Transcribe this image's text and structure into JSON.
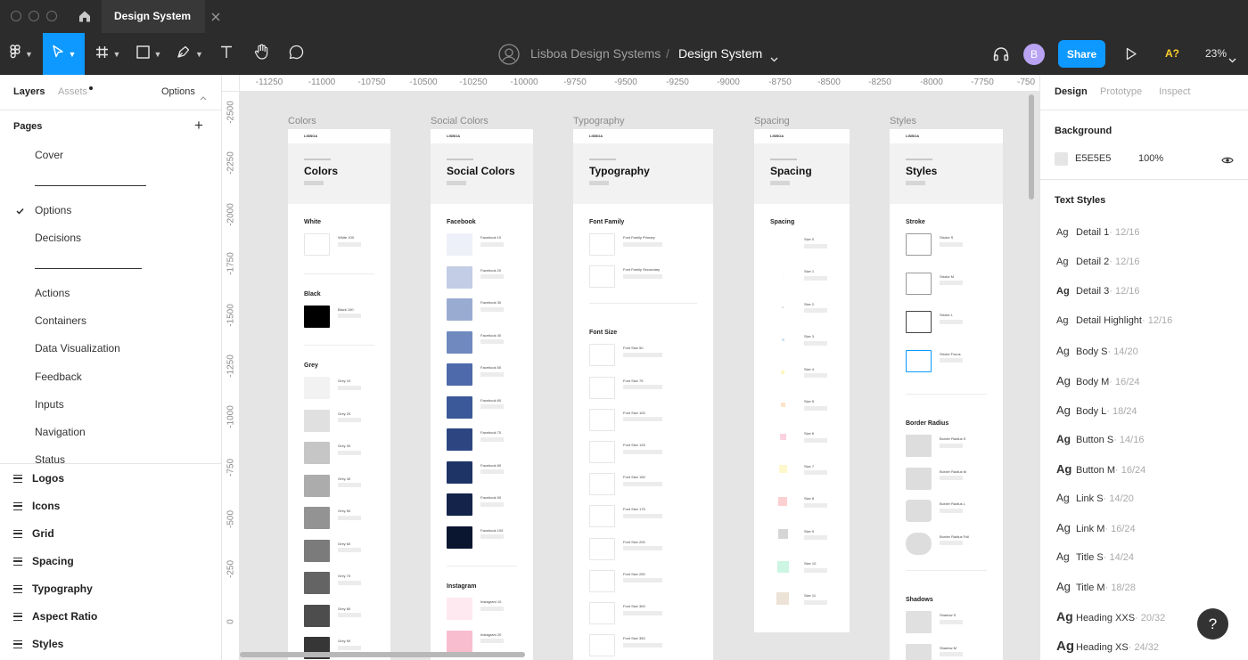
{
  "tabbar": {
    "file_tab": "Design System",
    "new_tab": "+"
  },
  "toolbar": {
    "team": "Lisboa Design Systems",
    "separator": "/",
    "file": "Design System",
    "avatar": "B",
    "share": "Share",
    "a11y": "A?",
    "zoom": "23%"
  },
  "left": {
    "tabs": {
      "layers": "Layers",
      "assets": "Assets",
      "options": "Options"
    },
    "pages_title": "Pages",
    "add": "+",
    "pages": [
      "Cover",
      "Options",
      "Decisions",
      "Actions",
      "Containers",
      "Data Visualization",
      "Feedback",
      "Inputs",
      "Navigation",
      "Status"
    ],
    "current_page": "Options",
    "layers": [
      "Logos",
      "Icons",
      "Grid",
      "Spacing",
      "Typography",
      "Aspect Ratio",
      "Styles"
    ]
  },
  "canvas": {
    "ruler_x": [
      "-11250",
      "-11000",
      "-10750",
      "-10500",
      "-10250",
      "-10000",
      "-9750",
      "-9500",
      "-9250",
      "-9000",
      "-8750",
      "-8500",
      "-8250",
      "-8000",
      "-7750",
      "-750"
    ],
    "ruler_y": [
      "-2500",
      "-2250",
      "-2000",
      "-1750",
      "-1500",
      "-1250",
      "-1000",
      "-750",
      "-500",
      "-250",
      "0"
    ],
    "frames": [
      {
        "label": "Colors",
        "title": "Colors",
        "brand": "LISBOA",
        "sections": [
          {
            "name": "White",
            "swatches": [
              {
                "color": "#ffffff",
                "label": "White 100"
              }
            ]
          },
          {
            "name": "Black",
            "swatches": [
              {
                "color": "#000000",
                "label": "Black 100"
              }
            ]
          },
          {
            "name": "Grey",
            "swatches": [
              {
                "color": "#f2f2f2",
                "label": "Grey 10"
              },
              {
                "color": "#e0e0e0",
                "label": "Grey 20"
              },
              {
                "color": "#c6c6c6",
                "label": "Grey 30"
              },
              {
                "color": "#acacac",
                "label": "Grey 40"
              },
              {
                "color": "#939393",
                "label": "Grey 50"
              },
              {
                "color": "#7b7b7b",
                "label": "Grey 60"
              },
              {
                "color": "#646464",
                "label": "Grey 70"
              },
              {
                "color": "#4d4d4d",
                "label": "Grey 80"
              },
              {
                "color": "#363636",
                "label": "Grey 90"
              }
            ]
          }
        ]
      },
      {
        "label": "Social Colors",
        "title": "Social Colors",
        "brand": "LISBOA",
        "sections": [
          {
            "name": "Facebook",
            "swatches": [
              {
                "color": "#edf0f8",
                "label": "Facebook 10"
              },
              {
                "color": "#c3cde5",
                "label": "Facebook 20"
              },
              {
                "color": "#9aabd2",
                "label": "Facebook 30"
              },
              {
                "color": "#7089bf",
                "label": "Facebook 40"
              },
              {
                "color": "#4e6aaa",
                "label": "Facebook 50"
              },
              {
                "color": "#3b5998",
                "label": "Facebook 60"
              },
              {
                "color": "#2d4682",
                "label": "Facebook 70"
              },
              {
                "color": "#1f3466",
                "label": "Facebook 80"
              },
              {
                "color": "#13234a",
                "label": "Facebook 90"
              },
              {
                "color": "#0a1530",
                "label": "Facebook 100"
              }
            ]
          },
          {
            "name": "Instagram",
            "swatches": [
              {
                "color": "#fde9ef",
                "label": "Instagram 10"
              },
              {
                "color": "#f9bdd0",
                "label": "Instagram 20"
              }
            ]
          }
        ]
      },
      {
        "label": "Typography",
        "title": "Typography",
        "brand": "LISBOA",
        "sections": [
          {
            "name": "Font Family",
            "items": [
              "Font Family Primary",
              "Font Family Secondary"
            ]
          },
          {
            "name": "Font Size",
            "items": [
              "Font Size 50",
              "Font Size 75",
              "Font Size 100",
              "Font Size 125",
              "Font Size 150",
              "Font Size 175",
              "Font Size 200",
              "Font Size 250",
              "Font Size 300",
              "Font Size 350"
            ]
          }
        ]
      },
      {
        "label": "Spacing",
        "title": "Spacing",
        "brand": "LISBOA",
        "sections": [
          {
            "name": "Spacing",
            "items": [
              {
                "label": "Size 0",
                "color": "#ffffff"
              },
              {
                "label": "Size 1",
                "color": "#eeeeee"
              },
              {
                "label": "Size 2",
                "color": "#dddddd"
              },
              {
                "label": "Size 3",
                "color": "#d0e4f7"
              },
              {
                "label": "Size 4",
                "color": "#fff6c2"
              },
              {
                "label": "Size 5",
                "color": "#fde2c8"
              },
              {
                "label": "Size 6",
                "color": "#fbd3e0"
              },
              {
                "label": "Size 7",
                "color": "#fff7cc"
              },
              {
                "label": "Size 8",
                "color": "#fcd0d0"
              },
              {
                "label": "Size 9",
                "color": "#d6d6d6"
              },
              {
                "label": "Size 10",
                "color": "#ccf5e4"
              },
              {
                "label": "Size 11",
                "color": "#ece2d6"
              }
            ]
          }
        ]
      },
      {
        "label": "Styles",
        "title": "Styles",
        "brand": "LISBOA",
        "sections": [
          {
            "name": "Stroke",
            "items": [
              "Stroke S",
              "Stroke M",
              "Stroke L",
              "Stroke Focus"
            ]
          },
          {
            "name": "Border Radius",
            "items": [
              "Border Radius S",
              "Border Radius M",
              "Border Radius L",
              "Border Radius Full"
            ]
          },
          {
            "name": "Shadows",
            "items": [
              "Shadow S",
              "Shadow M"
            ]
          }
        ]
      }
    ]
  },
  "right": {
    "tabs": {
      "design": "Design",
      "prototype": "Prototype",
      "inspect": "Inspect"
    },
    "background": {
      "title": "Background",
      "hex": "E5E5E5",
      "opacity": "100%",
      "swatch": "#e5e5e5"
    },
    "text_styles_title": "Text Styles",
    "text_styles": [
      {
        "ag": "Ag",
        "name": "Detail 1",
        "size": " · 12/16"
      },
      {
        "ag": "Ag",
        "name": "Detail 2",
        "size": " · 12/16"
      },
      {
        "ag": "Ag",
        "name": "Detail 3",
        "size": " · 12/16"
      },
      {
        "ag": "Ag",
        "name": "Detail Highlight",
        "size": " · 12/16"
      },
      {
        "ag": "Ag",
        "name": "Body S",
        "size": " · 14/20"
      },
      {
        "ag": "Ag",
        "name": "Body M",
        "size": " · 16/24"
      },
      {
        "ag": "Ag",
        "name": "Body L",
        "size": " · 18/24"
      },
      {
        "ag": "Ag",
        "name": "Button S",
        "size": " · 14/16"
      },
      {
        "ag": "Ag",
        "name": "Button M",
        "size": " · 16/24"
      },
      {
        "ag": "Ag",
        "name": "Link S",
        "size": " · 14/20"
      },
      {
        "ag": "Ag",
        "name": "Link M",
        "size": " · 16/24"
      },
      {
        "ag": "Ag",
        "name": "Title S",
        "size": " · 14/24"
      },
      {
        "ag": "Ag",
        "name": "Title M",
        "size": " · 18/28"
      },
      {
        "ag": "Ag",
        "name": "Heading XXS",
        "size": " · 20/32"
      },
      {
        "ag": "Ag",
        "name": "Heading XS",
        "size": " · 24/32"
      }
    ],
    "help": "?"
  }
}
